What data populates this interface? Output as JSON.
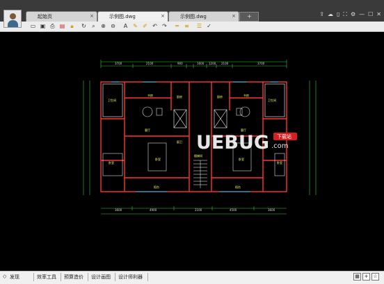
{
  "tabs": [
    {
      "label": "起始页",
      "close": "×"
    },
    {
      "label": "示例图.dwg",
      "close": "×"
    },
    {
      "label": "示例图.dwg",
      "close": "×"
    }
  ],
  "new_tab_label": "+",
  "status_items": [
    "发现",
    "效率工具",
    "预算造价",
    "设计画图",
    "设计师利器"
  ],
  "drawing": {
    "top_dims": [
      "3700",
      "2100",
      "900",
      "1600",
      "1200",
      "2100",
      "3700"
    ],
    "bottom_dims": [
      "3600",
      "4900",
      "2100",
      "4500",
      "3600"
    ],
    "room_labels": [
      "客厅",
      "客厅",
      "卧室",
      "卧室",
      "卧室",
      "卧室",
      "阳台",
      "阳台",
      "厨房",
      "厨房",
      "卫生间",
      "卫生间",
      "书房",
      "书房",
      "厨卫",
      "楼梯间"
    ]
  },
  "watermark": {
    "text": "UEBUG",
    "suffix": ".com",
    "badge": "下载站"
  },
  "colors": {
    "titlebar": "#3a3a3a",
    "canvas": "#000000",
    "wall": "#ff3333",
    "line": "#ffffff",
    "dim": "#33cc33",
    "room_text": "#ffff66",
    "furniture": "#dddddd"
  }
}
